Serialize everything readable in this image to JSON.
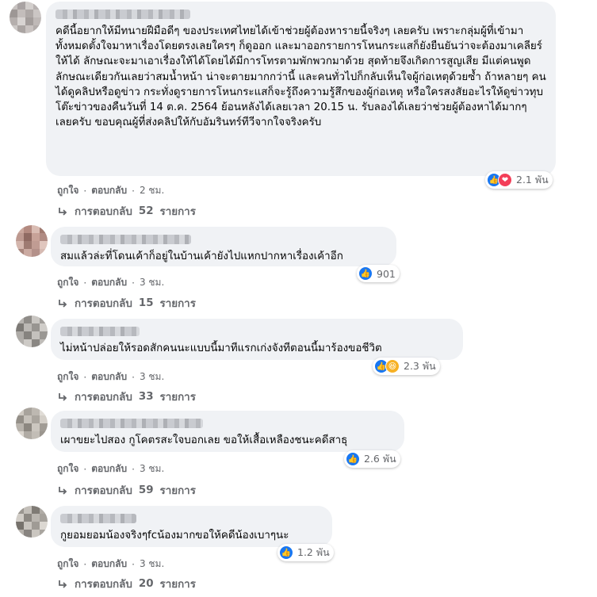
{
  "labels": {
    "like": "ถูกใจ",
    "reply": "ตอบกลับ",
    "dot": "·",
    "replies_prefix": "การตอบกลับ",
    "replies_suffix": "รายการ"
  },
  "colors": {
    "like": "#1877f2",
    "love": "#f33e58",
    "haha": "#f7b125",
    "bubble": "#f0f2f5"
  },
  "comments": [
    {
      "text": "คดีนี้อยากให้มีทนายฝีมือดีๆ ของประเทศไทยได้เข้าช่วยผู้ต้องหารายนี้จริงๆ เลยครับ เพราะกลุ่มผู้ที่เข้ามาทั้งหมดตั้งใจมาหาเรื่องโดยตรงเลยใครๆ ก็ดูออก และมาออกรายการโหนกระแสก็ยังยืนยันว่าจะต้องมาเคลียร์ให้ได้ ลักษณะจะมาเอาเรื่องให้ได้โดยได้มีการโทรตามพักพวกมาด้วย สุดท้ายจึงเกิดการสูญเสีย มีแต่คนพูด\nลักษณะเดียวกันเลยว่าสมน้ำหน้า น่าจะตายมากกว่านี้ และคนทั่วไปก็กลับเห็นใจผู้ก่อเหตุด้วยซ้ำ ถ้าหลายๆ คนได้ดูคลิปหรือดูข่าว กระทั่งดูรายการโหนกระแสก็จะรู้ถึงความรู้สึกของผู้ก่อเหตุ หรือใครสงสัยอะไรให้ดูข่าวทุบโต๊ะข่าวของคืนวันที่ 14 ต.ค. 2564 ย้อนหลังได้เลยเวลา 20.15 น. รับลองได้เลยว่าช่วยผู้ต้องหาได้มากๆ เลยครับ ขอบคุณผู้ที่ส่งคลิปให้กับอัมรินทร์ทีวีจากใจจริงครับ",
      "reaction_count": "2.1 พัน",
      "time": "2 ชม.",
      "reply_count": "52",
      "reactions": [
        "like",
        "love"
      ]
    },
    {
      "text": "สมแล้วล่ะที่โดนเค้าก็อยู่ในบ้านเค้ายังไปแหกปากหาเรื่องเค้าอีก",
      "reaction_count": "901",
      "time": "3 ชม.",
      "reply_count": "15",
      "reactions": [
        "like"
      ]
    },
    {
      "text": "ไม่หน้าปล่อยให้รอดสักคนนะแบบนี้มาทีแรกเก่งจังทีตอนนี้มาร้องขอชีวิต",
      "reaction_count": "2.3 พัน",
      "time": "3 ชม.",
      "reply_count": "33",
      "reactions": [
        "like",
        "haha"
      ]
    },
    {
      "text": "เผาขยะไปสอง กูโคตรสะใจบอกเลย ขอให้เสื้อเหลืองชนะคดีสาธุ",
      "reaction_count": "2.6 พัน",
      "time": "3 ชม.",
      "reply_count": "59",
      "reactions": [
        "like"
      ]
    },
    {
      "text": "กูยอมยอมน้องจริงๆfcน้องมากขอให้คดีน้องเบาๆนะ",
      "reaction_count": "1.2 พัน",
      "time": "3 ชม.",
      "reply_count": "20",
      "reactions": [
        "like"
      ]
    }
  ]
}
